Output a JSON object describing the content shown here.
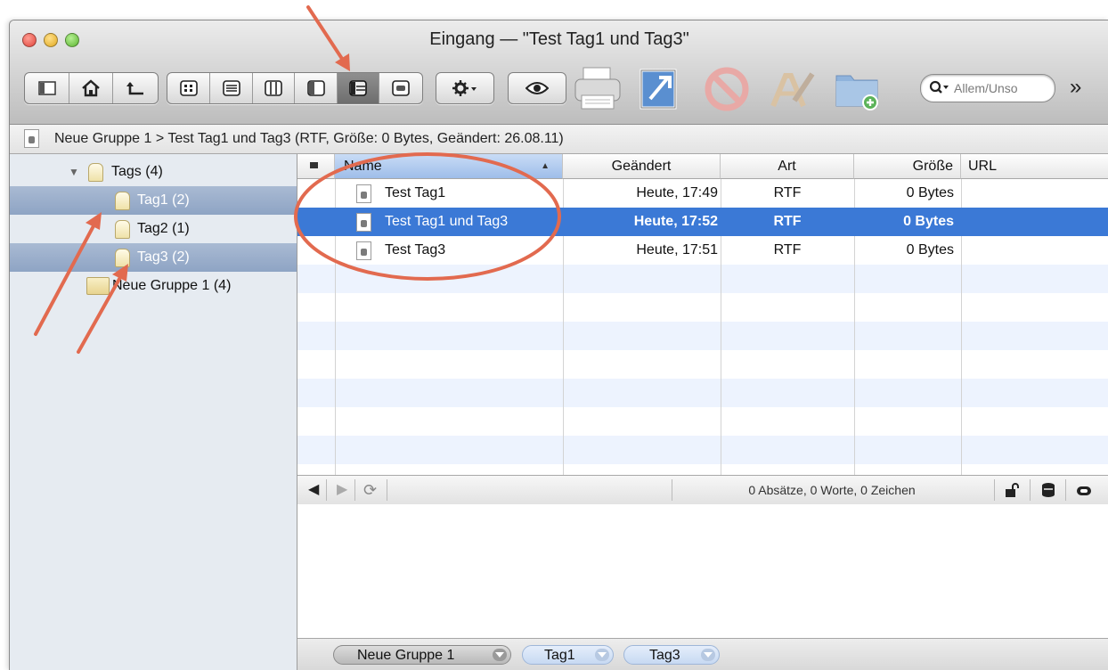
{
  "window": {
    "title": "Eingang — \"Test Tag1 und Tag3\""
  },
  "colors": {
    "accent": "#3b79d6",
    "annotation": "#e26a4f",
    "sidebar_selection": "#98abc9"
  },
  "toolbar": {
    "icons": [
      "sidebar-toggle-icon",
      "home-icon",
      "back-up-icon",
      "view-icons-icon",
      "view-list-icon",
      "view-columns-icon",
      "view-split-icon",
      "view-three-pane-icon",
      "view-preview-icon",
      "action-gear-icon",
      "quicklook-eye-icon",
      "print-icon",
      "open-external-icon",
      "delete-icon",
      "edit-icon",
      "new-group-icon"
    ],
    "search_placeholder": "Allem/Unso",
    "overflow": "»"
  },
  "pathbar": {
    "text": "Neue Gruppe 1 > Test Tag1 und Tag3 (RTF, Größe: 0 Bytes, Geändert: 26.08.11)"
  },
  "sidebar": {
    "items": [
      {
        "label": "Tags (4)",
        "icon": "tag-icon",
        "expanded": true
      },
      {
        "label": "Tag1 (2)",
        "icon": "tag-icon",
        "selected": true
      },
      {
        "label": "Tag2 (1)",
        "icon": "tag-icon",
        "selected": false
      },
      {
        "label": "Tag3 (2)",
        "icon": "tag-icon",
        "selected": true
      },
      {
        "label": "Neue Gruppe 1 (4)",
        "icon": "folder-icon",
        "selected": false
      }
    ]
  },
  "list": {
    "columns": [
      "Name",
      "Geändert",
      "Art",
      "Größe",
      "URL"
    ],
    "rows": [
      {
        "name": "Test Tag1",
        "modified": "Heute, 17:49",
        "kind": "RTF",
        "size": "0 Bytes",
        "url": "",
        "selected": false
      },
      {
        "name": "Test Tag1 und Tag3",
        "modified": "Heute, 17:52",
        "kind": "RTF",
        "size": "0 Bytes",
        "url": "",
        "selected": true
      },
      {
        "name": "Test Tag3",
        "modified": "Heute, 17:51",
        "kind": "RTF",
        "size": "0 Bytes",
        "url": "",
        "selected": false
      }
    ]
  },
  "editor_bar": {
    "status": "0 Absätze, 0 Worte, 0 Zeichen"
  },
  "tagbar": {
    "tags": [
      "Neue Gruppe 1",
      "Tag1",
      "Tag3"
    ]
  }
}
